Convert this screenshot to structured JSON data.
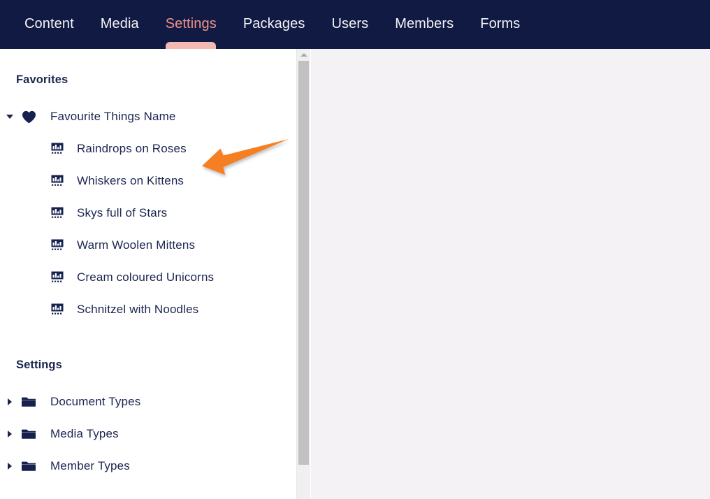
{
  "navbar": {
    "items": [
      {
        "label": "Content",
        "active": false
      },
      {
        "label": "Media",
        "active": false
      },
      {
        "label": "Settings",
        "active": true
      },
      {
        "label": "Packages",
        "active": false
      },
      {
        "label": "Users",
        "active": false
      },
      {
        "label": "Members",
        "active": false
      },
      {
        "label": "Forms",
        "active": false
      }
    ],
    "background_color": "#101a43",
    "active_color": "#f0938b",
    "active_indicator_color": "#f3b9b3"
  },
  "sidebar": {
    "favorites": {
      "heading": "Favorites",
      "root": {
        "label": "Favourite Things Name",
        "icon": "heart-icon",
        "expanded": true,
        "caret": "caret-down-icon"
      },
      "children": [
        {
          "label": "Raindrops on Roses",
          "icon": "data-type-icon"
        },
        {
          "label": "Whiskers on Kittens",
          "icon": "data-type-icon"
        },
        {
          "label": "Skys full of Stars",
          "icon": "data-type-icon"
        },
        {
          "label": "Warm Woolen Mittens",
          "icon": "data-type-icon"
        },
        {
          "label": "Cream coloured Unicorns",
          "icon": "data-type-icon"
        },
        {
          "label": "Schnitzel with Noodles",
          "icon": "data-type-icon"
        }
      ]
    },
    "settings": {
      "heading": "Settings",
      "items": [
        {
          "label": "Document Types",
          "icon": "folder-icon",
          "caret": "caret-right-icon",
          "expanded": false
        },
        {
          "label": "Media Types",
          "icon": "folder-icon",
          "caret": "caret-right-icon",
          "expanded": false
        },
        {
          "label": "Member Types",
          "icon": "folder-icon",
          "caret": "caret-right-icon",
          "expanded": false
        }
      ]
    },
    "text_color": "#1b264f"
  },
  "scrollbar": {
    "up_button": "scroll-up-arrow-icon",
    "thumb": "scrollbar-thumb",
    "thumb_color": "#c1c1c1",
    "track_color": "#f0f0f0"
  },
  "annotation": {
    "arrow": "orange-arrow-annotation",
    "color": "#f57f20"
  },
  "content": {
    "background_color": "#f4f2f4"
  }
}
